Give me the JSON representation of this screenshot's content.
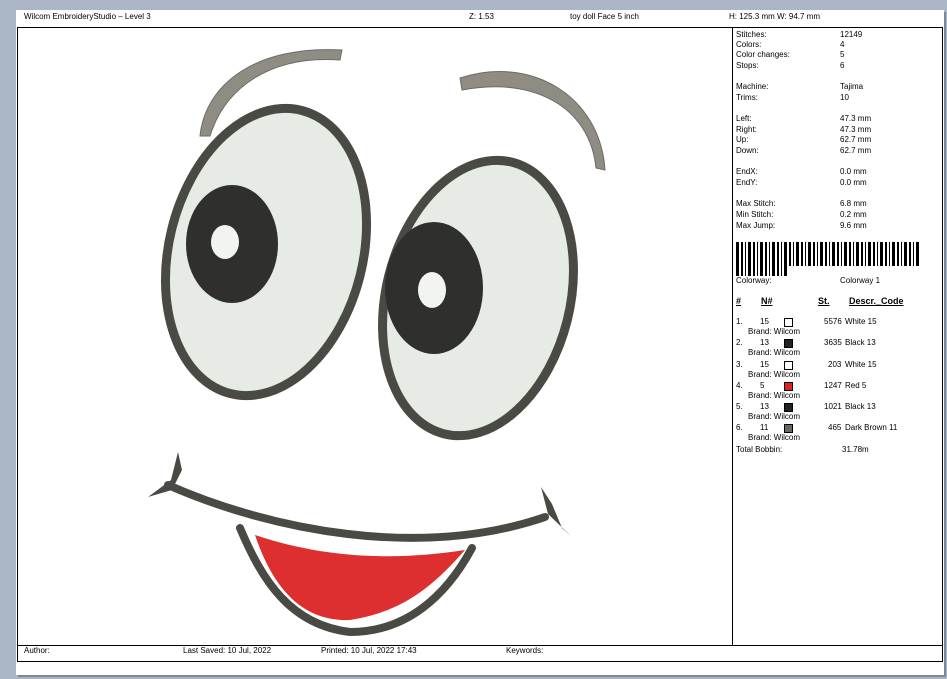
{
  "header": {
    "app_title": "Wilcom EmbroideryStudio – Level 3",
    "zoom": "Z: 1.53",
    "design_name": "toy doll Face 5 inch",
    "size": "H: 125.3 mm   W: 94.7 mm"
  },
  "stats": [
    {
      "label": "Stitches:",
      "value": "12149"
    },
    {
      "label": "Colors:",
      "value": "4"
    },
    {
      "label": "Color changes:",
      "value": "5"
    },
    {
      "label": "Stops:",
      "value": "6"
    },
    {
      "label": "Machine:",
      "value": "Tajima"
    },
    {
      "label": "Trims:",
      "value": "10"
    },
    {
      "label": "Left:",
      "value": "47.3 mm"
    },
    {
      "label": "Right:",
      "value": "47.3 mm"
    },
    {
      "label": "Up:",
      "value": "62.7 mm"
    },
    {
      "label": "Down:",
      "value": "62.7 mm"
    },
    {
      "label": "EndX:",
      "value": "0.0 mm"
    },
    {
      "label": "EndY:",
      "value": "0.0 mm"
    },
    {
      "label": "Max Stitch:",
      "value": "6.8 mm"
    },
    {
      "label": "Min Stitch:",
      "value": "0.2 mm"
    },
    {
      "label": "Max Jump:",
      "value": "9.6 mm"
    }
  ],
  "colorway": {
    "label": "Colorway:",
    "value": "Colorway 1"
  },
  "table_headers": {
    "num": "#",
    "needle": "N#",
    "stitches": "St.",
    "desc": "Descr._Code"
  },
  "colors": [
    {
      "index": "1.",
      "needle": "15",
      "stitches": "5576",
      "desc": "White 15",
      "brand": "Brand: Wilcom",
      "swatch": "#ffffff"
    },
    {
      "index": "2.",
      "needle": "13",
      "stitches": "3635",
      "desc": "Black 13",
      "brand": "Brand: Wilcom",
      "swatch": "#222222"
    },
    {
      "index": "3.",
      "needle": "15",
      "stitches": "203",
      "desc": "White 15",
      "brand": "Brand: Wilcom",
      "swatch": "#ffffff"
    },
    {
      "index": "4.",
      "needle": "5",
      "stitches": "1247",
      "desc": "Red 5",
      "brand": "Brand: Wilcom",
      "swatch": "#e02020"
    },
    {
      "index": "5.",
      "needle": "13",
      "stitches": "1021",
      "desc": "Black 13",
      "brand": "Brand: Wilcom",
      "swatch": "#222222"
    },
    {
      "index": "6.",
      "needle": "11",
      "stitches": "465",
      "desc": "Dark Brown 11",
      "brand": "Brand: Wilcom",
      "swatch": "#6b6560"
    }
  ],
  "total_bobbin": {
    "label": "Total Bobbin:",
    "value": "31.78m"
  },
  "footer": {
    "author": "Author:",
    "last_saved": "Last Saved: 10 Jul, 2022",
    "printed": "Printed: 10 Jul, 2022 17:43",
    "keywords": "Keywords:"
  },
  "design_colors": {
    "outline": "#4a4a45",
    "eye_white": "#e6ebe6",
    "pupil": "#2f302d",
    "highlight": "#f2f4f0",
    "mouth": "#dd2f2f",
    "brow": "#8f8c84"
  }
}
